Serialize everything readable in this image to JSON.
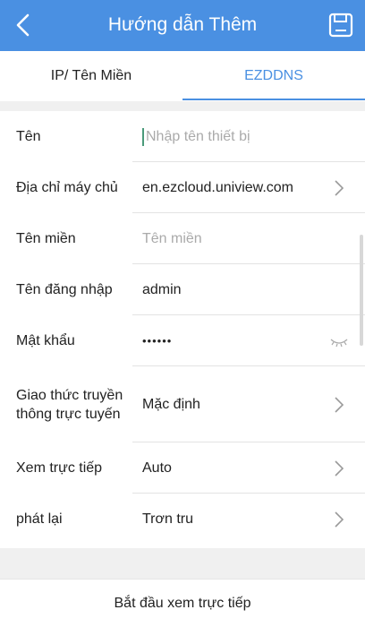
{
  "header": {
    "title": "Hướng dẫn Thêm",
    "back_icon": "back-arrow-icon",
    "save_icon": "save-icon",
    "color": "#4a90e2"
  },
  "tabs": [
    {
      "label": "IP/ Tên Miền",
      "active": false
    },
    {
      "label": "EZDDNS",
      "active": true
    }
  ],
  "form": {
    "rows": [
      {
        "label": "Tên",
        "value": "",
        "placeholder": "Nhập tên thiết bị"
      },
      {
        "label": "Địa chỉ máy chủ",
        "value": "en.ezcloud.uniview.com"
      },
      {
        "label": "Tên miền",
        "value": "",
        "placeholder": "Tên miền"
      },
      {
        "label": "Tên đăng nhập",
        "value": "admin"
      },
      {
        "label": "Mật khẩu",
        "value": "••••••"
      },
      {
        "label": "Giao thức truyền thông trực tuyến",
        "value": "Mặc định"
      },
      {
        "label": "Xem trực tiếp",
        "value": "Auto"
      },
      {
        "label": "phát lại",
        "value": "Trơn tru"
      }
    ]
  },
  "start_button": {
    "label": "Bắt đầu xem trực tiếp"
  }
}
